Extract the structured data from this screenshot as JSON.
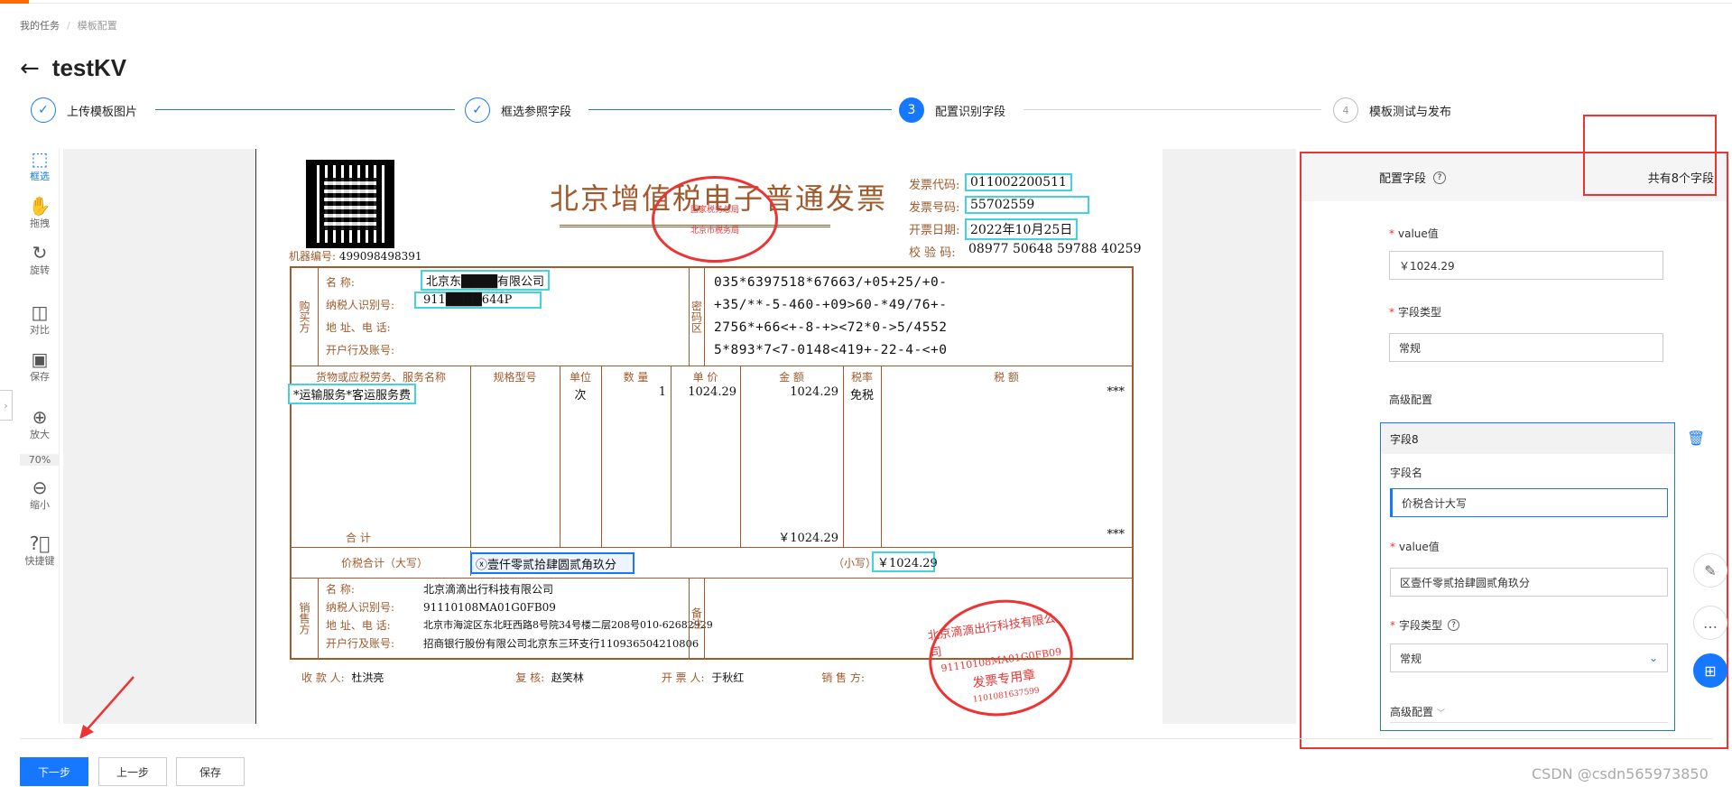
{
  "breadcrumb": {
    "home": "我的任务",
    "current": "模板配置"
  },
  "page": {
    "title": "testKV",
    "back_icon": "←"
  },
  "steps": [
    {
      "num": "✓",
      "label": "上传模板图片",
      "state": "done"
    },
    {
      "num": "✓",
      "label": "框选参照字段",
      "state": "done"
    },
    {
      "num": "3",
      "label": "配置识别字段",
      "state": "active"
    },
    {
      "num": "4",
      "label": "模板测试与发布",
      "state": "todo"
    }
  ],
  "toolbar": {
    "items": [
      {
        "icon": "select-box-icon",
        "label": "框选"
      },
      {
        "icon": "hand-drag-icon",
        "label": "拖拽"
      },
      {
        "icon": "rotate-icon",
        "label": "旋转"
      },
      {
        "icon": "compare-icon",
        "label": "对比"
      },
      {
        "icon": "save-icon",
        "label": "保存"
      },
      {
        "icon": "zoom-in-icon",
        "label": "放大"
      },
      {
        "icon": "zoom-out-icon",
        "label": "缩小"
      },
      {
        "icon": "help-icon",
        "label": "快捷键"
      }
    ],
    "zoom": "70%"
  },
  "invoice": {
    "title": "北京增值税电子普通发票",
    "stamp_top": "国家税务总局",
    "stamp_bottom": "北京市税务局",
    "code_label": "发票代码:",
    "code": "011002200511",
    "number_label": "发票号码:",
    "number": "55702559",
    "date_label": "开票日期:",
    "date": "2022年10月25日",
    "check_label": "校 验 码:",
    "check": "08977 50648 59788 40259",
    "machine_label": "机器编号:",
    "machine": "499098498391",
    "buyer_side": "购买方",
    "buyer_name_label": "名        称:",
    "buyer_name": "北京东████有限公司",
    "buyer_tax_label": "纳税人识别号:",
    "buyer_tax": "911████644P",
    "buyer_addr_label": "地 址、电 话:",
    "buyer_bank_label": "开户行及账号:",
    "cipher_side": "密码区",
    "cipher": [
      "035*6397518*67663/+05+25/+0-",
      "+35/**-5-460-+09>60-*49/76+-",
      "2756*+66<+-8-+><72*0->5/4552",
      "5*893*7<7-0148<419+-22-4-<+0"
    ],
    "col_item": "货物或应税劳务、服务名称",
    "col_spec": "规格型号",
    "col_unit": "单位",
    "col_qty": "数  量",
    "col_price": "单  价",
    "col_amount": "金  额",
    "col_rate": "税率",
    "col_tax": "税  额",
    "item_name": "*运输服务*客运服务费",
    "unit": "次",
    "qty": "1",
    "price": "1024.29",
    "amount": "1024.29",
    "rate": "免税",
    "tax": "***",
    "sum_label": "合        计",
    "sum_amount": "￥1024.29",
    "sum_tax": "***",
    "total_label": "价税合计（大写）",
    "total_words": "ⓧ壹仟零贰拾肆圆贰角玖分",
    "small_label": "（小写）",
    "total_small": "￥1024.29",
    "seller_side": "销售方",
    "seller_name_label": "名        称:",
    "seller_name": "北京滴滴出行科技有限公司",
    "seller_tax_label": "纳税人识别号:",
    "seller_tax": "91110108MA01G0FB09",
    "seller_addr_label": "地 址、电 话:",
    "seller_addr": "北京市海淀区东北旺西路8号院34号楼二层208号010-62682929",
    "seller_bank_label": "开户行及账号:",
    "seller_bank": "招商银行股份有限公司北京东三环支行110936504210806",
    "remark_side": "备注",
    "seal_name": "北京滴滴出行科技有限公司",
    "seal_tax": "91110108MA01G0FB09",
    "seal_type": "发票专用章",
    "seal_no": "1101081637599",
    "payee_label": "收 款 人:",
    "payee": "杜洪亮",
    "reviewer_label": "复  核:",
    "reviewer": "赵笑林",
    "drawer_label": "开 票 人:",
    "drawer": "于秋红",
    "seller_label": "销 售 方:"
  },
  "panel": {
    "header": "配置字段",
    "help_icon": "help-icon",
    "count": "共有8个字段",
    "value_label": "value值",
    "value": "￥1024.29",
    "type_label": "字段类型",
    "type_value": "常规",
    "advanced": "高级配置",
    "field_card": {
      "title": "字段8",
      "name_label": "字段名",
      "name_value": "价税合计大写",
      "value_label": "value值",
      "value": "区壹仟零贰拾肆圆贰角玖分",
      "type_label": "字段类型",
      "type_value": "常规",
      "advanced": "高级配置"
    }
  },
  "footer": {
    "next": "下一步",
    "prev": "上一步",
    "save": "保存"
  },
  "watermark": "CSDN @csdn565973850"
}
